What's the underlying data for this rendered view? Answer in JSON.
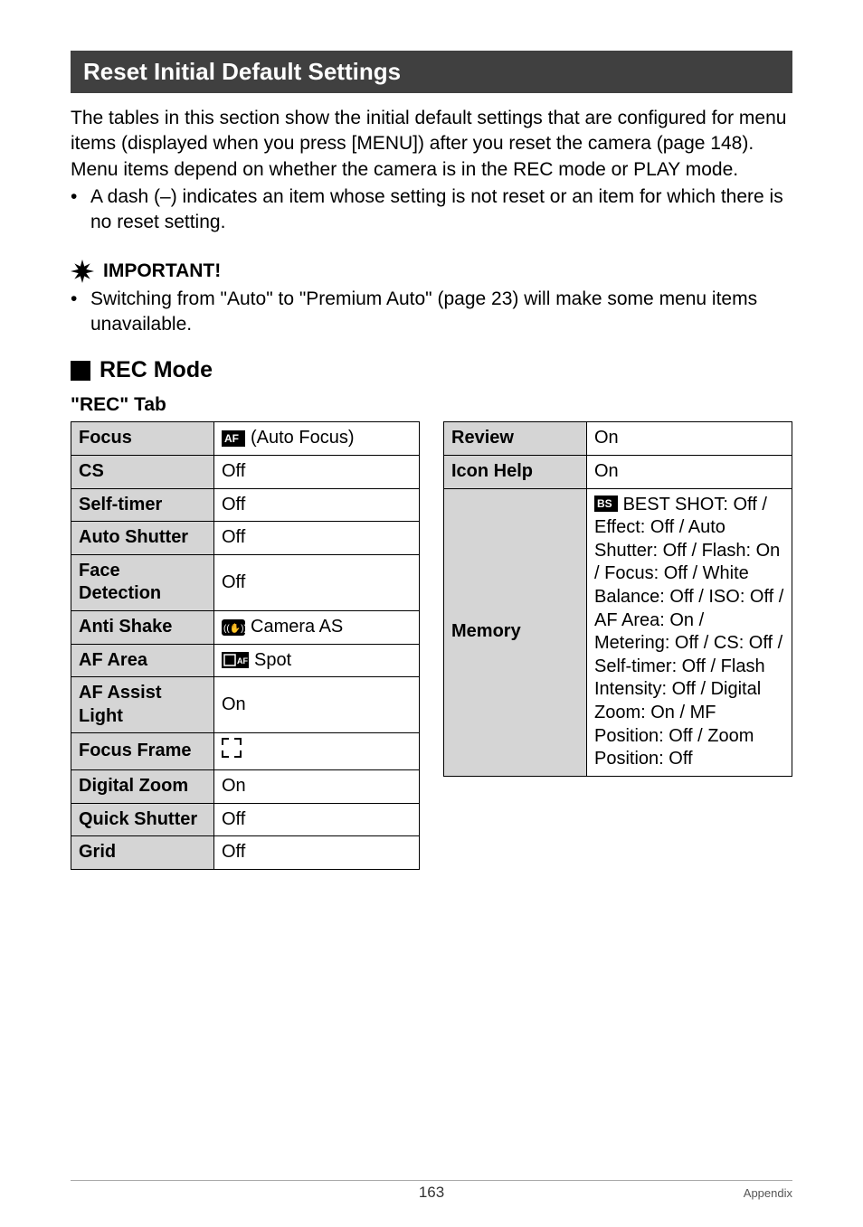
{
  "section_title": "Reset Initial Default Settings",
  "intro_para": "The tables in this section show the initial default settings that are configured for menu items (displayed when you press [MENU]) after you reset the camera (page 148). Menu items depend on whether the camera is in the REC mode or PLAY mode.",
  "intro_bullet": "A dash (–) indicates an item whose setting is not reset or an item for which there is no reset setting.",
  "important_label": "IMPORTANT!",
  "important_bullet": "Switching from \"Auto\" to \"Premium Auto\" (page 23) will make some menu items unavailable.",
  "subhead": "REC Mode",
  "tab_head": "\"REC\" Tab",
  "left_table": [
    {
      "label": "Focus",
      "icon": "af-icon",
      "value": "(Auto Focus)"
    },
    {
      "label": "CS",
      "value": "Off"
    },
    {
      "label": "Self-timer",
      "value": "Off"
    },
    {
      "label": "Auto Shutter",
      "value": "Off"
    },
    {
      "label": "Face Detection",
      "value": "Off"
    },
    {
      "label": "Anti Shake",
      "icon": "camera-as-icon",
      "value": "Camera AS"
    },
    {
      "label": "AF Area",
      "icon": "spot-icon",
      "value": "Spot"
    },
    {
      "label": "AF Assist Light",
      "value": "On"
    },
    {
      "label": "Focus Frame",
      "icon": "corners-icon",
      "value": ""
    },
    {
      "label": "Digital Zoom",
      "value": "On"
    },
    {
      "label": "Quick Shutter",
      "value": "Off"
    },
    {
      "label": "Grid",
      "value": "Off"
    }
  ],
  "right_table": {
    "review": {
      "label": "Review",
      "value": "On"
    },
    "icon_help": {
      "label": "Icon Help",
      "value": "On"
    },
    "memory": {
      "label": "Memory",
      "icon": "bs-icon",
      "icon_text": "BEST SHOT:",
      "rest": "Off / Effect: Off / Auto Shutter: Off / Flash: On / Focus: Off / White Balance: Off / ISO: Off / AF Area: On / Metering: Off / CS: Off / Self-timer: Off / Flash Intensity: Off / Digital Zoom: On / MF Position: Off / Zoom Position: Off"
    }
  },
  "footer": {
    "page": "163",
    "section": "Appendix"
  }
}
